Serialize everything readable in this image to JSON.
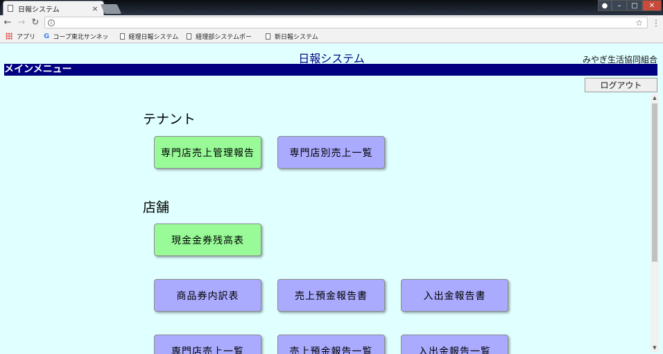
{
  "browser": {
    "tab_title": "日報システム",
    "tab_close": "×",
    "address_url": "",
    "bookmarks": [
      {
        "label": "アプリ"
      },
      {
        "label": "コープ東北サンネッ"
      },
      {
        "label": "経理日報システム"
      },
      {
        "label": "経理部システムポー"
      },
      {
        "label": "新日報システム"
      }
    ]
  },
  "header": {
    "title": "日報システム",
    "organization": "みやぎ生活協同組合",
    "menu_bar": "メインメニュー",
    "logout_label": "ログアウト"
  },
  "sections": [
    {
      "title": "テナント",
      "buttons": [
        {
          "label": "専門店売上管理報告",
          "color": "#98fb98"
        },
        {
          "label": "専門店別売上一覧",
          "color": "#aaaaff"
        }
      ]
    },
    {
      "title": "店舗",
      "buttons": [
        {
          "label": "現金金券残高表",
          "color": "#98fb98"
        },
        {
          "label": "商品券内訳表",
          "color": "#aaaaff"
        },
        {
          "label": "売上預金報告書",
          "color": "#aaaaff"
        },
        {
          "label": "入出金報告書",
          "color": "#aaaaff"
        },
        {
          "label": "専門店売上一覧",
          "color": "#aaaaff"
        },
        {
          "label": "売上預金報告一覧",
          "color": "#aaaaff"
        },
        {
          "label": "入出金報告一覧",
          "color": "#aaaaff"
        }
      ]
    }
  ],
  "colors": {
    "page_bg": "#e0ffff",
    "menu_bar": "#000080",
    "green_button": "#98fb98",
    "blue_button": "#aaaaff"
  }
}
